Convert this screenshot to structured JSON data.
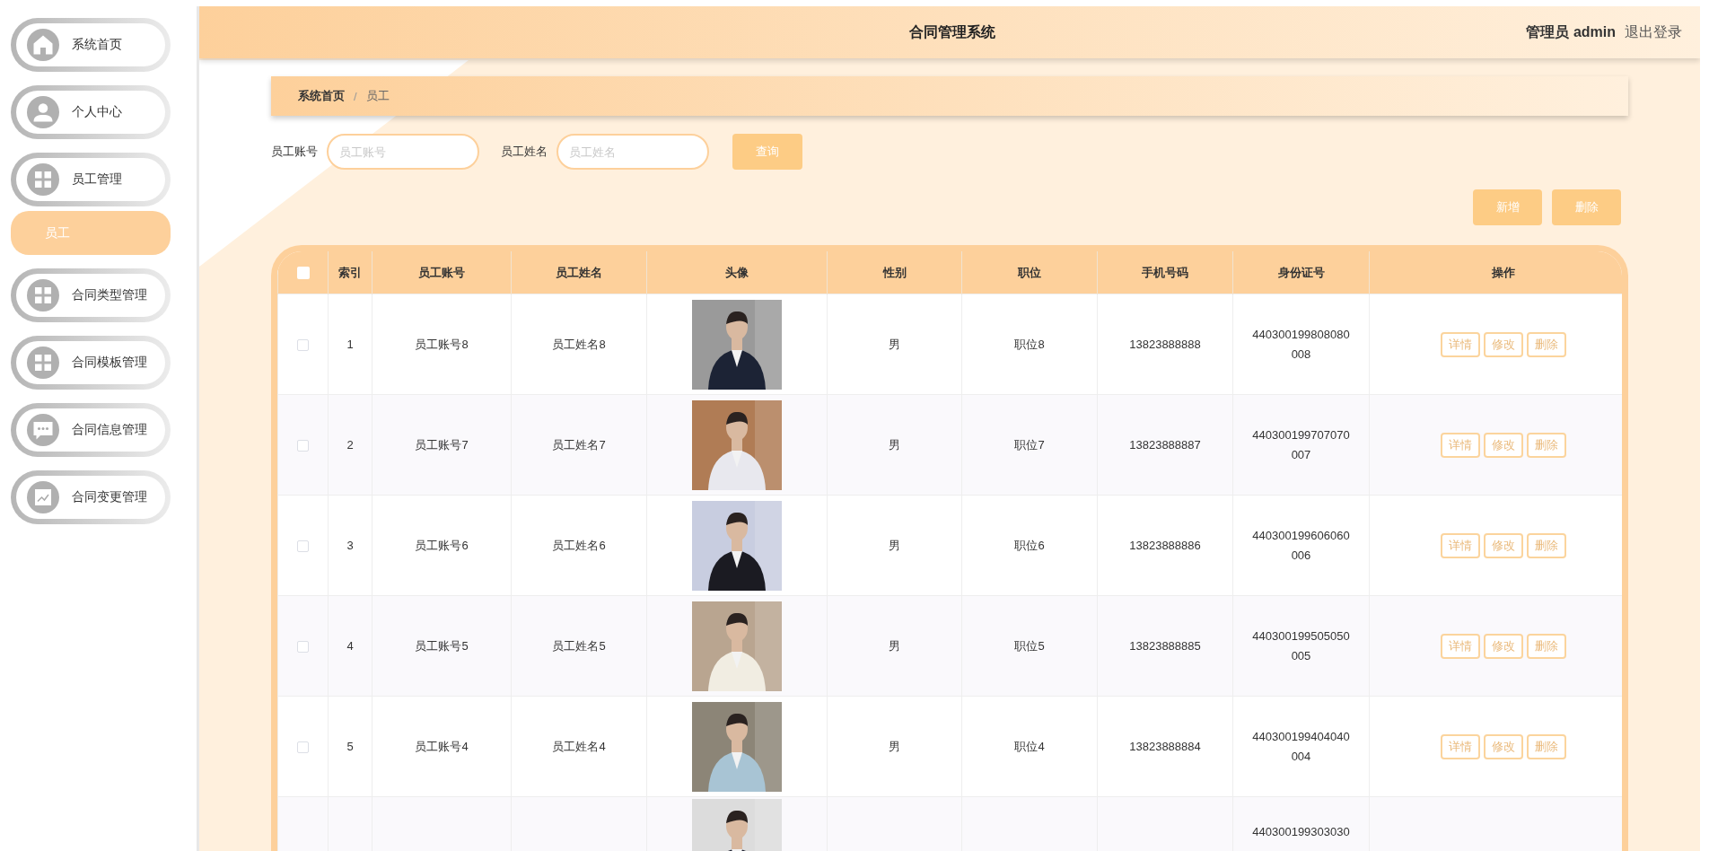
{
  "sidebar": {
    "items": [
      {
        "label": "系统首页"
      },
      {
        "label": "个人中心"
      },
      {
        "label": "员工管理",
        "children": [
          {
            "label": "员工",
            "selected": true
          }
        ]
      },
      {
        "label": "合同类型管理"
      },
      {
        "label": "合同模板管理"
      },
      {
        "label": "合同信息管理"
      },
      {
        "label": "合同变更管理"
      }
    ]
  },
  "header": {
    "title": "合同管理系统",
    "user_role": "管理员",
    "user_name": "admin",
    "logout": "退出登录"
  },
  "breadcrumb": {
    "items": [
      "系统首页",
      "员工"
    ],
    "separator": "/"
  },
  "search": {
    "fields": [
      {
        "label": "员工账号",
        "placeholder": "员工账号"
      },
      {
        "label": "员工姓名",
        "placeholder": "员工姓名"
      }
    ],
    "button": "查询"
  },
  "actions": [
    "新增",
    "删除"
  ],
  "table": {
    "header_checked": false,
    "columns": [
      "索引",
      "员工账号",
      "员工姓名",
      "头像",
      "性别",
      "职位",
      "手机号码",
      "身份证号",
      "操作"
    ],
    "rows": [
      {
        "checked": false,
        "index": "1",
        "account": "员工账号8",
        "name": "员工姓名8",
        "gender": "男",
        "position": "职位8",
        "phone": "13823888888",
        "id_number": "440300199808080008",
        "actions": [
          "详情",
          "修改",
          "删除"
        ]
      },
      {
        "checked": false,
        "index": "2",
        "account": "员工账号7",
        "name": "员工姓名7",
        "gender": "男",
        "position": "职位7",
        "phone": "13823888887",
        "id_number": "440300199707070007",
        "actions": [
          "详情",
          "修改",
          "删除"
        ]
      },
      {
        "checked": false,
        "index": "3",
        "account": "员工账号6",
        "name": "员工姓名6",
        "gender": "男",
        "position": "职位6",
        "phone": "13823888886",
        "id_number": "440300199606060006",
        "actions": [
          "详情",
          "修改",
          "删除"
        ]
      },
      {
        "checked": false,
        "index": "4",
        "account": "员工账号5",
        "name": "员工姓名5",
        "gender": "男",
        "position": "职位5",
        "phone": "13823888885",
        "id_number": "440300199505050005",
        "actions": [
          "详情",
          "修改",
          "删除"
        ]
      },
      {
        "checked": false,
        "index": "5",
        "account": "员工账号4",
        "name": "员工姓名4",
        "gender": "男",
        "position": "职位4",
        "phone": "13823888884",
        "id_number": "440300199404040004",
        "actions": [
          "详情",
          "修改",
          "删除"
        ]
      },
      {
        "id_number": "440300199303030"
      }
    ]
  }
}
